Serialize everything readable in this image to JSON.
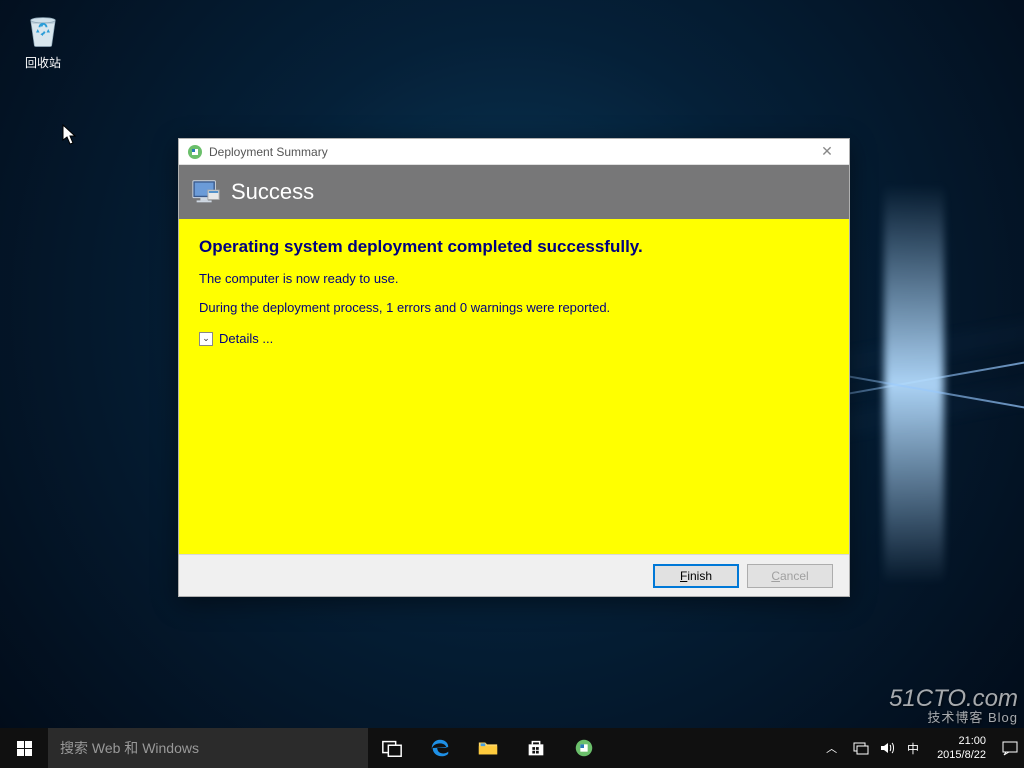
{
  "desktop": {
    "recycle_bin_label": "回收站"
  },
  "dialog": {
    "title": "Deployment Summary",
    "banner_title": "Success",
    "heading": "Operating system deployment completed successfully.",
    "line1": "The computer is now ready to use.",
    "line2": "During the deployment process, 1 errors and 0 warnings were reported.",
    "details_label": "Details ...",
    "finish_label": "Finish",
    "cancel_label": "Cancel"
  },
  "taskbar": {
    "search_placeholder": "搜索 Web 和 Windows"
  },
  "tray": {
    "ime": "中",
    "time": "21:00",
    "date": "2015/8/22"
  },
  "watermark": {
    "main": "51CTO.com",
    "sub": "技术博客 Blog"
  }
}
